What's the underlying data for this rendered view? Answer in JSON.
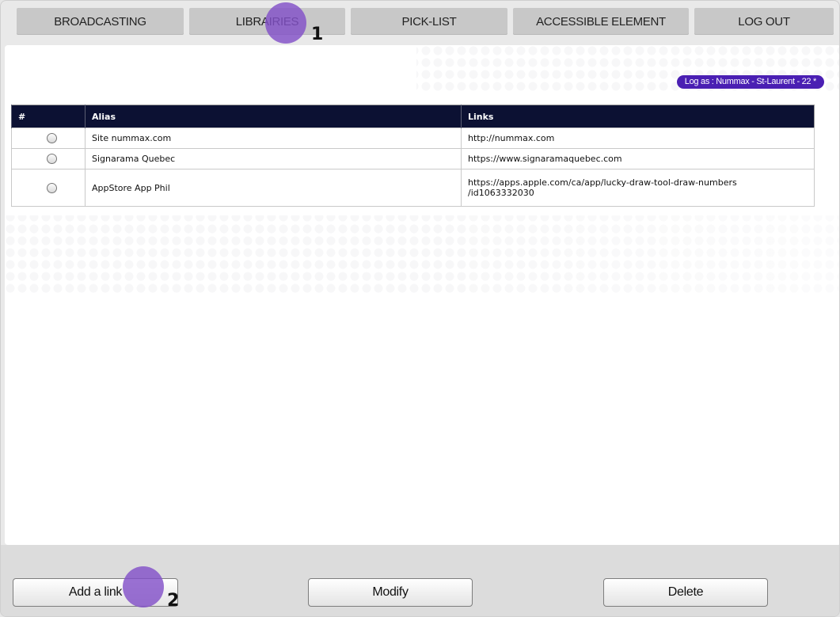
{
  "nav": {
    "tabs": [
      {
        "label": "BROADCASTING"
      },
      {
        "label": "LIBRAIRIES"
      },
      {
        "label": "PICK-LIST"
      },
      {
        "label": "ACCESSIBLE ELEMENT"
      },
      {
        "label": "LOG OUT"
      }
    ]
  },
  "login_badge": "Log as : Nummax - St-Laurent - 22 *",
  "table": {
    "headers": [
      "#",
      "Alias",
      "Links"
    ],
    "rows": [
      {
        "alias": "Site nummax.com",
        "link": "http://nummax.com",
        "link_cont": ""
      },
      {
        "alias": "Signarama Quebec",
        "link": "https://www.signaramaquebec.com",
        "link_cont": ""
      },
      {
        "alias": "AppStore App Phil",
        "link": "https://apps.apple.com/ca/app/lucky-draw-tool-draw-numbers",
        "link_cont": "/id1063332030"
      }
    ]
  },
  "buttons": {
    "add": "Add a link",
    "modify": "Modify",
    "delete": "Delete"
  },
  "markers": {
    "m1": "1",
    "m2": "2"
  },
  "colors": {
    "header_bg": "#0c1133",
    "badge_bg": "#4a1fb3",
    "marker": "#8250c8"
  },
  "icons": {
    "radio": "radio-button-icon",
    "marker": "step-marker-icon"
  }
}
